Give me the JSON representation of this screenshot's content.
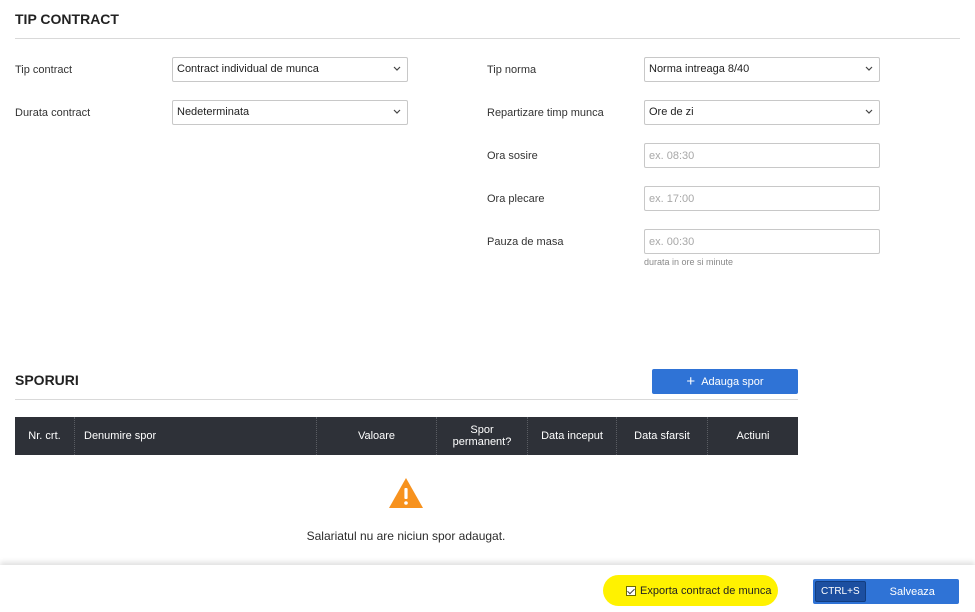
{
  "contract": {
    "title": "TIP CONTRACT",
    "tip_contract": {
      "label": "Tip contract",
      "value": "Contract individual de munca"
    },
    "durata_contract": {
      "label": "Durata contract",
      "value": "Nedeterminata"
    },
    "tip_norma": {
      "label": "Tip norma",
      "value": "Norma intreaga 8/40"
    },
    "repartizare": {
      "label": "Repartizare timp munca",
      "value": "Ore de zi"
    },
    "ora_sosire": {
      "label": "Ora sosire",
      "placeholder": "ex. 08:30"
    },
    "ora_plecare": {
      "label": "Ora plecare",
      "placeholder": "ex. 17:00"
    },
    "pauza": {
      "label": "Pauza de masa",
      "placeholder": "ex. 00:30",
      "hint": "durata in ore si minute"
    }
  },
  "sporuri": {
    "title": "SPORURI",
    "add_button": {
      "icon": "plus-icon",
      "label": "Adauga spor"
    },
    "columns": [
      "Nr. crt.",
      "Denumire spor",
      "Valoare",
      "Spor permanent?",
      "Data inceput",
      "Data sfarsit",
      "Actiuni"
    ],
    "empty_icon": "warning-icon",
    "empty_message": "Salariatul nu are niciun spor adaugat."
  },
  "footer": {
    "export_label": "Exporta contract de munca",
    "export_checked": true,
    "shortcut": "CTRL+S",
    "save_label": "Salveaza"
  },
  "colors": {
    "primary": "#2f73d6",
    "table_header": "#2e3138",
    "warning": "#f7921e",
    "highlight": "#fff200"
  }
}
